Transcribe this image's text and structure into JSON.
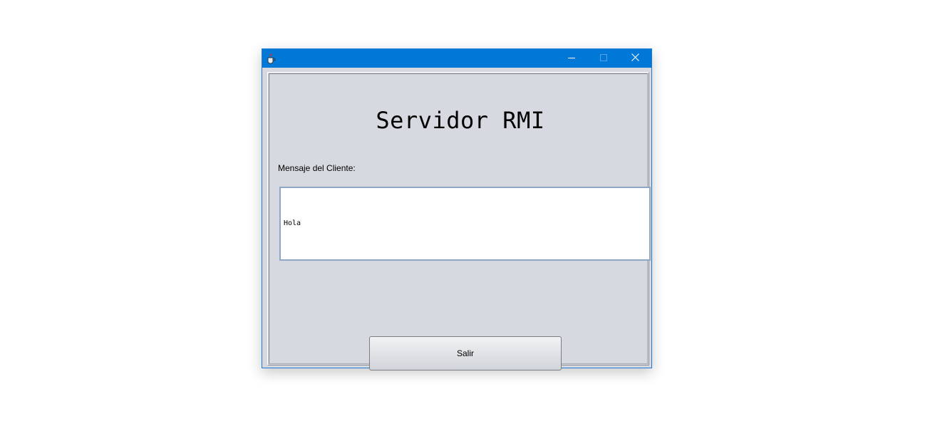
{
  "window": {
    "title_bar_color": "#0078d7",
    "icon": "java-cup-icon",
    "controls": {
      "minimize_icon": "minimize-icon",
      "maximize_icon": "maximize-icon",
      "close_icon": "close-icon"
    }
  },
  "main": {
    "heading": "Servidor RMI",
    "message_label": "Mensaje del Cliente:",
    "message_value": "Hola",
    "exit_button_label": "Salir"
  },
  "colors": {
    "background": "#d6d9e0",
    "textarea_border": "#8fa6c4"
  }
}
